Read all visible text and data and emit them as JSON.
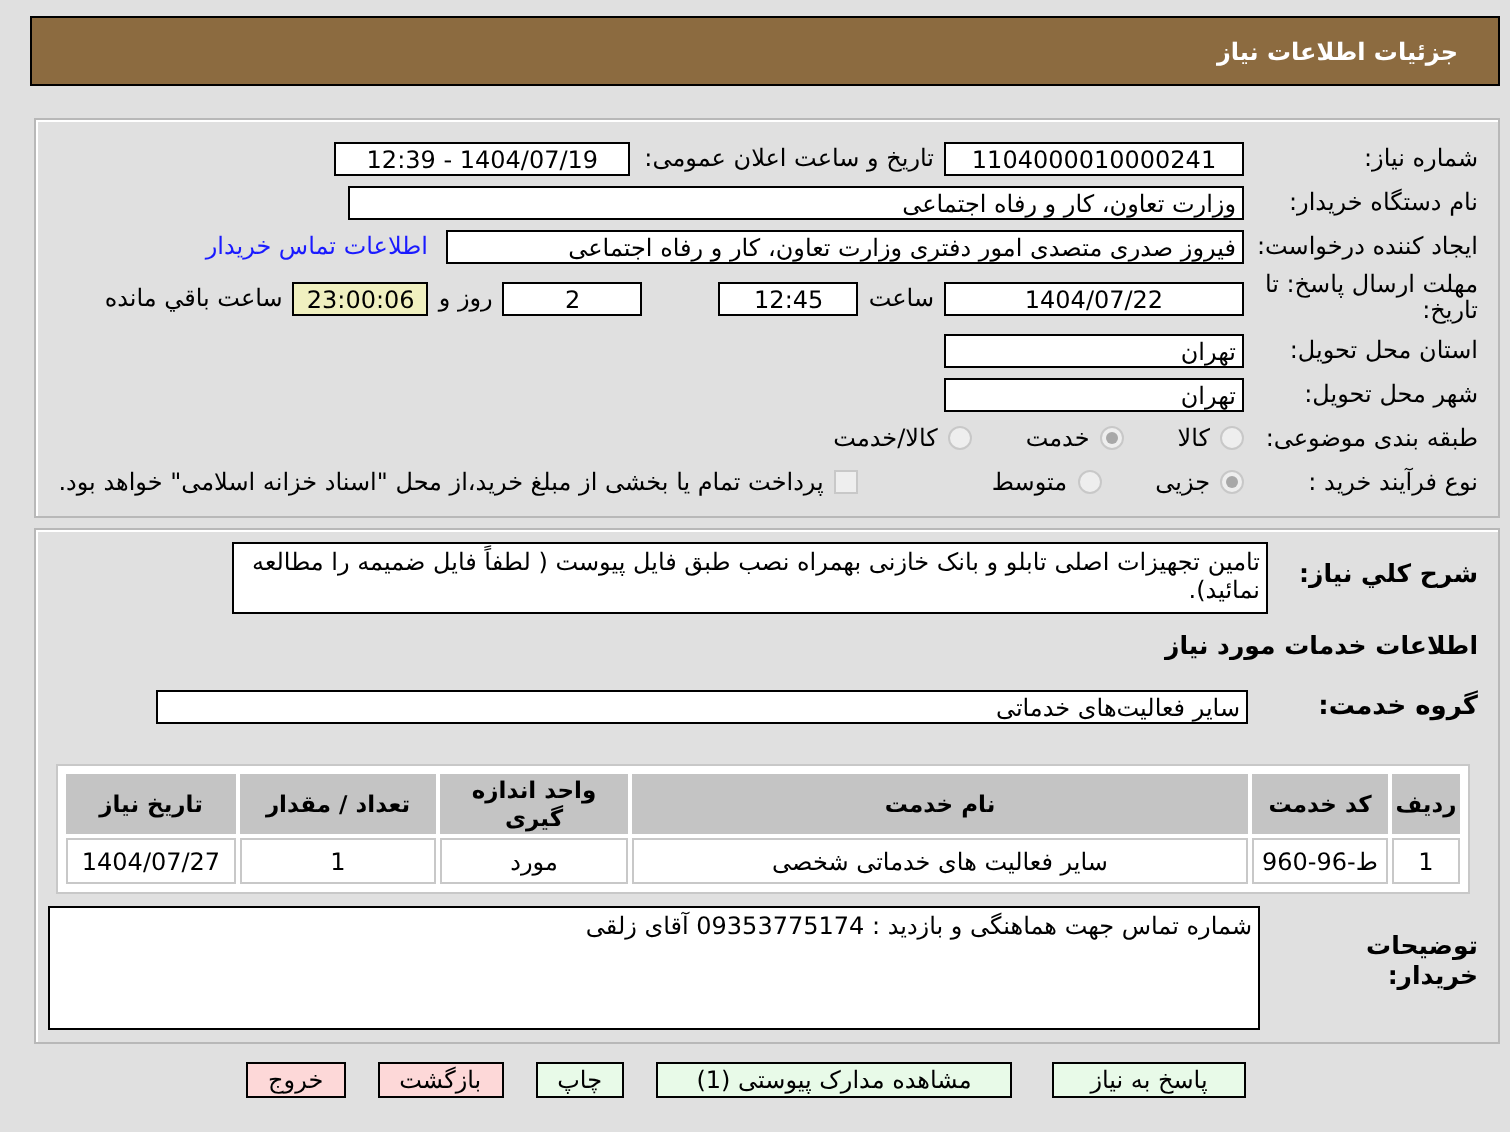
{
  "header": {
    "title": "جزئیات اطلاعات نیاز"
  },
  "need_number": {
    "label": "شماره نیاز:",
    "value": "1104000010000241"
  },
  "announce": {
    "label": "تاریخ و ساعت اعلان عمومی:",
    "value": "1404/07/19 - 12:39"
  },
  "buyer_org": {
    "label": "نام دستگاه خریدار:",
    "value": "وزارت تعاون، کار و رفاه اجتماعی"
  },
  "requester": {
    "label": "ایجاد کننده درخواست:",
    "value": "فیروز صدری متصدی امور دفتری وزارت تعاون، کار و رفاه اجتماعی",
    "link": "اطلاعات تماس خریدار"
  },
  "deadline": {
    "label": "مهلت ارسال پاسخ: تا تاریخ:",
    "date": "1404/07/22",
    "time_label": "ساعت",
    "time": "12:45",
    "days": "2",
    "days_label": "روز و",
    "remaining": "23:00:06",
    "remaining_label": "ساعت باقي مانده"
  },
  "province": {
    "label": "استان محل تحویل:",
    "value": "تهران"
  },
  "city": {
    "label": "شهر محل تحویل:",
    "value": "تهران"
  },
  "category": {
    "label": "طبقه بندی موضوعی:",
    "options": [
      {
        "label": "کالا",
        "selected": false
      },
      {
        "label": "خدمت",
        "selected": true
      },
      {
        "label": "کالا/خدمت",
        "selected": false
      }
    ]
  },
  "process": {
    "label": "نوع فرآیند خرید :",
    "options": [
      {
        "label": "جزیی",
        "selected": true
      },
      {
        "label": "متوسط",
        "selected": false
      }
    ],
    "payment": {
      "label": "پرداخت تمام یا بخشی از مبلغ خرید،از محل \"اسناد خزانه اسلامی\" خواهد بود.",
      "checked": false
    }
  },
  "description": {
    "label": "شرح کلي نياز:",
    "value": "تامین تجهیزات اصلی تابلو و بانک خازنی بهمراه نصب طبق فایل پیوست ( لطفاً فایل ضمیمه را مطالعه نمائید)."
  },
  "services_heading": "اطلاعات خدمات مورد نياز",
  "service_group": {
    "label": "گروه خدمت:",
    "value": "سایر فعالیت‌های خدماتی"
  },
  "table": {
    "columns": [
      "ردیف",
      "کد خدمت",
      "نام خدمت",
      "واحد اندازه گیری",
      "تعداد / مقدار",
      "تاریخ نیاز"
    ],
    "rows": [
      [
        "1",
        "ط-96-960",
        "سایر فعالیت های خدماتی شخصی",
        "مورد",
        "1",
        "1404/07/27"
      ]
    ]
  },
  "buyer_notes": {
    "label": "توضیحات خریدار:",
    "value": "شماره تماس جهت هماهنگی و بازدید : 09353775174 آقای زلقی"
  },
  "buttons": [
    {
      "label": "پاسخ به نیاز",
      "kind": "action"
    },
    {
      "label": "مشاهده مدارک پیوستی (1)",
      "kind": "action"
    },
    {
      "label": "چاپ",
      "kind": "action"
    },
    {
      "label": "بازگشت",
      "kind": "exit"
    },
    {
      "label": "خروج",
      "kind": "exit"
    }
  ]
}
